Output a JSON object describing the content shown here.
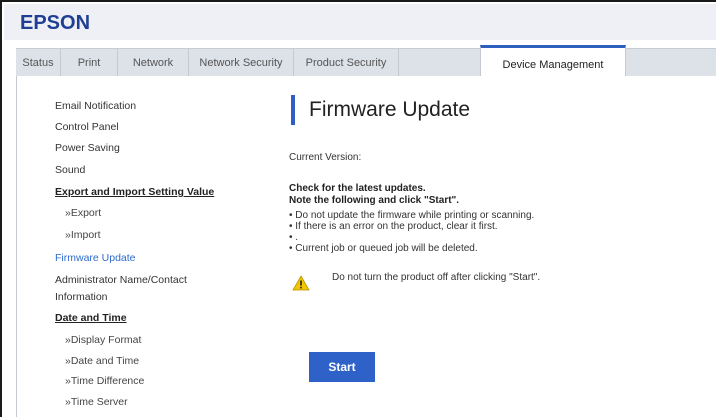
{
  "header": {
    "logo": "EPSON"
  },
  "tabs": [
    {
      "label": "Status"
    },
    {
      "label": "Print"
    },
    {
      "label": "Network"
    },
    {
      "label": "Network Security"
    },
    {
      "label": "Product Security"
    },
    {
      "label": "Device Management",
      "active": true
    }
  ],
  "sidebar": {
    "items": [
      {
        "label": "Email Notification"
      },
      {
        "label": "Control Panel"
      },
      {
        "label": "Power Saving"
      },
      {
        "label": "Sound"
      },
      {
        "label": "Export and Import Setting Value"
      },
      {
        "label": "»Export"
      },
      {
        "label": "»Import"
      },
      {
        "label": "Firmware Update"
      },
      {
        "label": "Administrator Name/Contact Information"
      },
      {
        "label": "Date and Time"
      },
      {
        "label": "»Display Format"
      },
      {
        "label": "»Date and Time"
      },
      {
        "label": "»Time Difference"
      },
      {
        "label": "»Time Server"
      }
    ]
  },
  "main": {
    "title": "Firmware Update",
    "current_version_label": "Current Version:",
    "check_line1": "Check for the latest updates.",
    "check_line2": "Note the following and click \"Start\".",
    "notes": [
      "•  Do not update the firmware while printing or scanning.",
      "•  If there is an error on the product, clear it first.",
      "•  .",
      "•  Current job or queued job will be deleted."
    ],
    "warning": "Do not turn the product off after clicking \"Start\".",
    "start_label": "Start"
  },
  "colors": {
    "accent": "#2e62c8",
    "logo": "#1f3f95",
    "active_link": "#2d6bcf",
    "warning": "#f2c500"
  }
}
